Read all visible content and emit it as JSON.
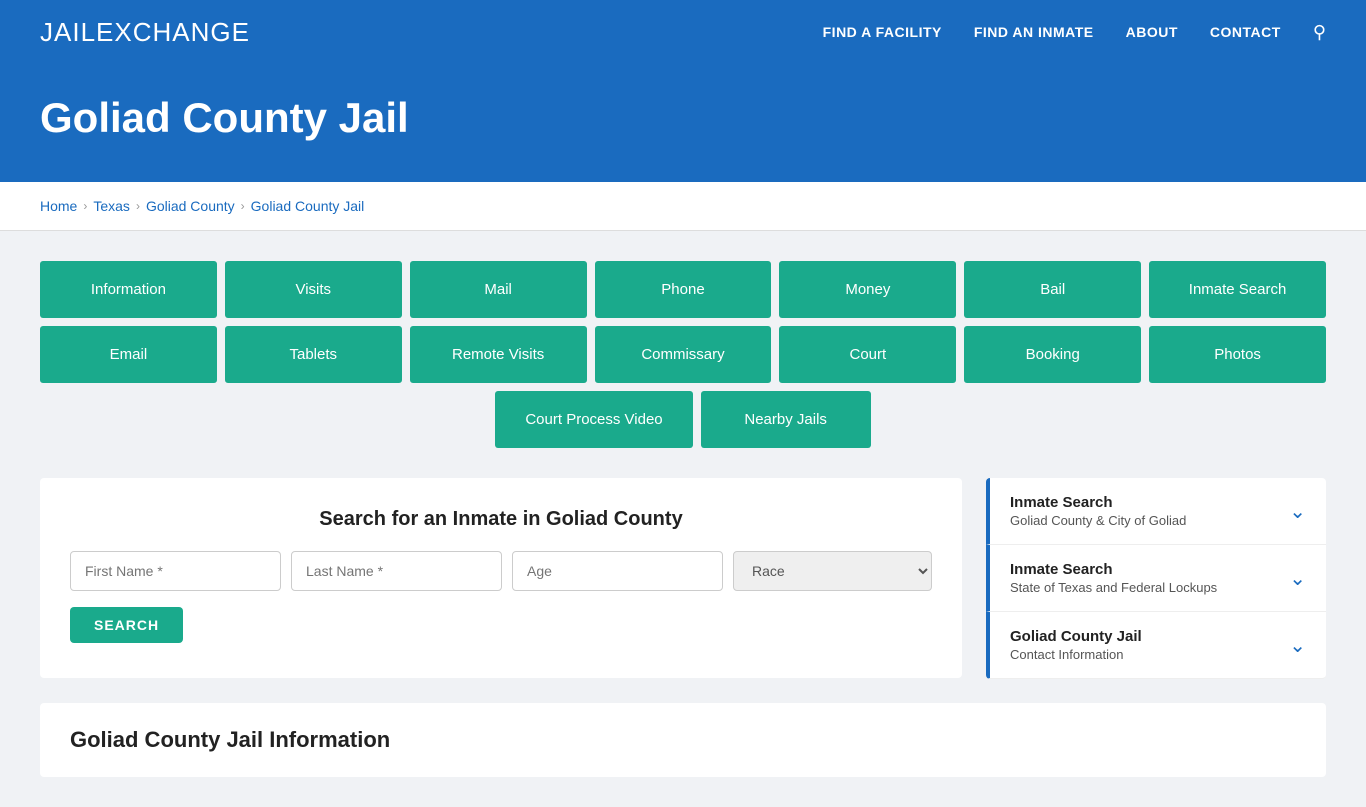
{
  "header": {
    "logo_jail": "JAIL",
    "logo_x": "E",
    "logo_xchange": "XCHANGE",
    "nav": [
      {
        "label": "FIND A FACILITY",
        "href": "#"
      },
      {
        "label": "FIND AN INMATE",
        "href": "#"
      },
      {
        "label": "ABOUT",
        "href": "#"
      },
      {
        "label": "CONTACT",
        "href": "#"
      }
    ]
  },
  "hero": {
    "title": "Goliad County Jail"
  },
  "breadcrumb": {
    "items": [
      {
        "label": "Home",
        "href": "#"
      },
      {
        "label": "Texas",
        "href": "#"
      },
      {
        "label": "Goliad County",
        "href": "#"
      },
      {
        "label": "Goliad County Jail",
        "href": "#"
      }
    ]
  },
  "grid_row1": [
    {
      "label": "Information"
    },
    {
      "label": "Visits"
    },
    {
      "label": "Mail"
    },
    {
      "label": "Phone"
    },
    {
      "label": "Money"
    },
    {
      "label": "Bail"
    },
    {
      "label": "Inmate Search"
    }
  ],
  "grid_row2": [
    {
      "label": "Email"
    },
    {
      "label": "Tablets"
    },
    {
      "label": "Remote Visits"
    },
    {
      "label": "Commissary"
    },
    {
      "label": "Court"
    },
    {
      "label": "Booking"
    },
    {
      "label": "Photos"
    }
  ],
  "grid_row3": [
    {
      "label": "Court Process Video"
    },
    {
      "label": "Nearby Jails"
    }
  ],
  "search": {
    "title": "Search for an Inmate in Goliad County",
    "first_name_placeholder": "First Name *",
    "last_name_placeholder": "Last Name *",
    "age_placeholder": "Age",
    "race_placeholder": "Race",
    "button_label": "SEARCH"
  },
  "sidebar": {
    "items": [
      {
        "title": "Inmate Search",
        "subtitle": "Goliad County & City of Goliad"
      },
      {
        "title": "Inmate Search",
        "subtitle": "State of Texas and Federal Lockups"
      },
      {
        "title": "Goliad County Jail",
        "subtitle": "Contact Information"
      }
    ]
  },
  "info_section": {
    "title": "Goliad County Jail Information"
  }
}
